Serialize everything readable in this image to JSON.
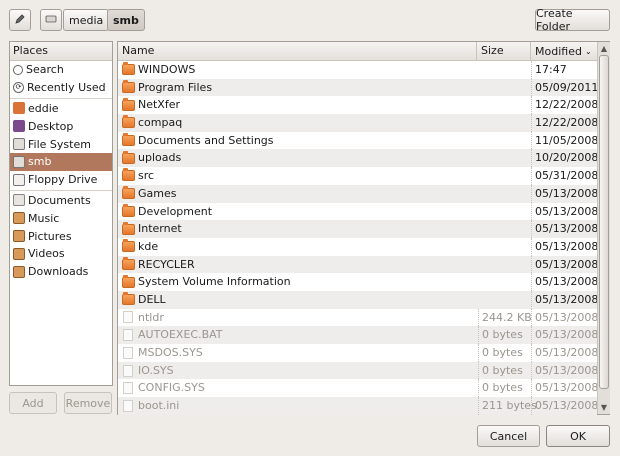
{
  "toolbar": {
    "edit_icon": "pencil-icon",
    "path_icon": "disk-icon",
    "breadcrumbs": [
      "media",
      "smb"
    ],
    "create_folder_label": "Create Folder"
  },
  "places": {
    "header": "Places",
    "items": [
      {
        "label": "Search",
        "icon": "search-icon"
      },
      {
        "label": "Recently Used",
        "icon": "recent-icon"
      },
      {
        "label": "eddie",
        "icon": "home-icon"
      },
      {
        "label": "Desktop",
        "icon": "desktop-icon"
      },
      {
        "label": "File System",
        "icon": "drive-icon"
      },
      {
        "label": "smb",
        "icon": "drive-icon",
        "selected": true
      },
      {
        "label": "Floppy Drive",
        "icon": "floppy-icon"
      },
      {
        "label": "Documents",
        "icon": "folder-icon"
      },
      {
        "label": "Music",
        "icon": "music-icon"
      },
      {
        "label": "Pictures",
        "icon": "pictures-icon"
      },
      {
        "label": "Videos",
        "icon": "videos-icon"
      },
      {
        "label": "Downloads",
        "icon": "downloads-icon"
      }
    ],
    "add_label": "Add",
    "remove_label": "Remove"
  },
  "files": {
    "columns": {
      "name": "Name",
      "size": "Size",
      "modified": "Modified"
    },
    "rows": [
      {
        "name": "WINDOWS",
        "size": "",
        "modified": "17:47",
        "type": "folder"
      },
      {
        "name": "Program Files",
        "size": "",
        "modified": "05/09/2011",
        "type": "folder"
      },
      {
        "name": "NetXfer",
        "size": "",
        "modified": "12/22/2008",
        "type": "folder"
      },
      {
        "name": "compaq",
        "size": "",
        "modified": "12/22/2008",
        "type": "folder"
      },
      {
        "name": "Documents and Settings",
        "size": "",
        "modified": "11/05/2008",
        "type": "folder"
      },
      {
        "name": "uploads",
        "size": "",
        "modified": "10/20/2008",
        "type": "folder"
      },
      {
        "name": "src",
        "size": "",
        "modified": "05/31/2008",
        "type": "folder"
      },
      {
        "name": "Games",
        "size": "",
        "modified": "05/13/2008",
        "type": "folder"
      },
      {
        "name": "Development",
        "size": "",
        "modified": "05/13/2008",
        "type": "folder"
      },
      {
        "name": "Internet",
        "size": "",
        "modified": "05/13/2008",
        "type": "folder"
      },
      {
        "name": "kde",
        "size": "",
        "modified": "05/13/2008",
        "type": "folder"
      },
      {
        "name": "RECYCLER",
        "size": "",
        "modified": "05/13/2008",
        "type": "folder"
      },
      {
        "name": "System Volume Information",
        "size": "",
        "modified": "05/13/2008",
        "type": "folder"
      },
      {
        "name": "DELL",
        "size": "",
        "modified": "05/13/2008",
        "type": "folder"
      },
      {
        "name": "ntldr",
        "size": "244.2 KB",
        "modified": "05/13/2008",
        "type": "file"
      },
      {
        "name": "AUTOEXEC.BAT",
        "size": "0 bytes",
        "modified": "05/13/2008",
        "type": "file"
      },
      {
        "name": "MSDOS.SYS",
        "size": "0 bytes",
        "modified": "05/13/2008",
        "type": "file"
      },
      {
        "name": "IO.SYS",
        "size": "0 bytes",
        "modified": "05/13/2008",
        "type": "file"
      },
      {
        "name": "CONFIG.SYS",
        "size": "0 bytes",
        "modified": "05/13/2008",
        "type": "file"
      },
      {
        "name": "boot.ini",
        "size": "211 bytes",
        "modified": "05/13/2008",
        "type": "file"
      }
    ]
  },
  "actions": {
    "cancel_label": "Cancel",
    "ok_label": "OK"
  },
  "colors": {
    "selection": "#b1785d",
    "folder": "#e4772c",
    "background": "#efebe7"
  }
}
